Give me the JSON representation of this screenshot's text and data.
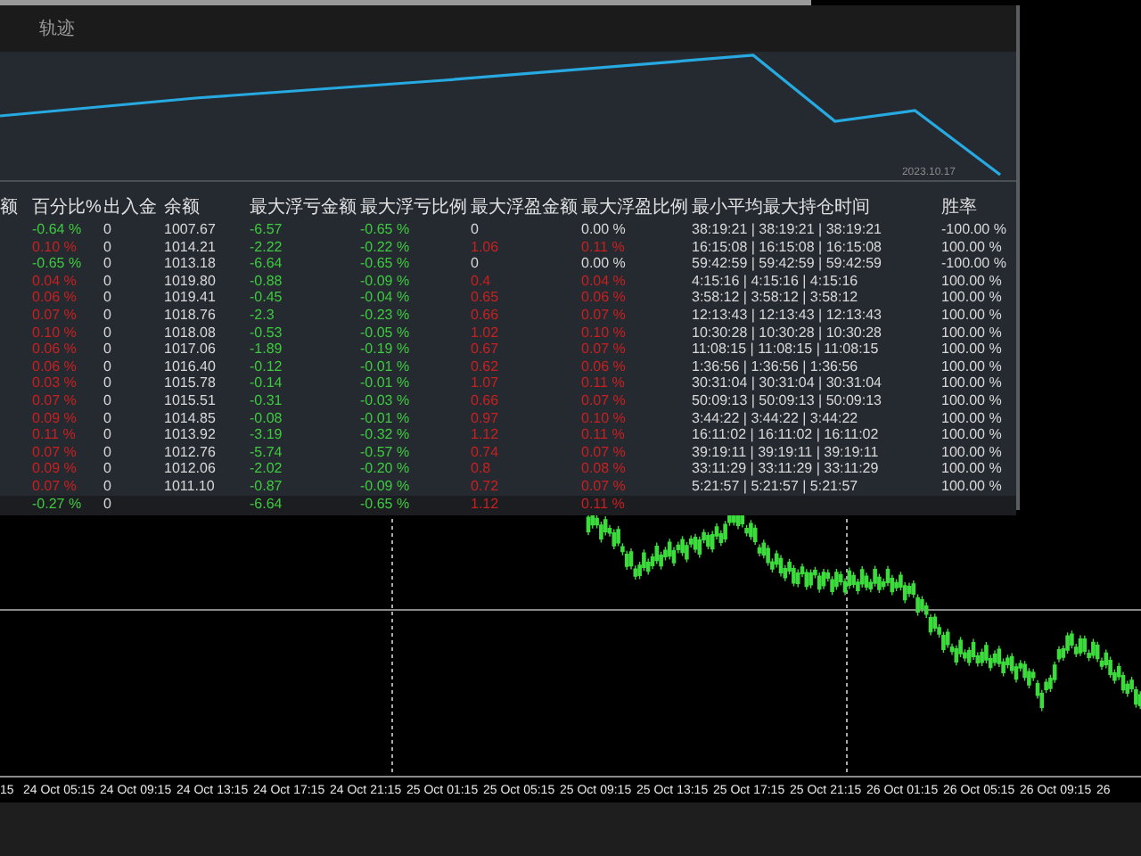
{
  "panel": {
    "title": "轨迹",
    "equity_date": "2023.10.17",
    "columns": [
      "额",
      "百分比%",
      "出入金",
      "余额",
      "最大浮亏金额",
      "最大浮亏比例",
      "最大浮盈金额",
      "最大浮盈比例",
      "最小平均最大持仓时间",
      "胜率"
    ],
    "rows": [
      {
        "percent": {
          "text": "-0.64 %",
          "color": "#3ec93e"
        },
        "flow": "0",
        "balance": "1007.67",
        "loss_amount": "-6.57",
        "loss_ratio": "-0.65 %",
        "profit_amount": {
          "text": "0",
          "color": "#d8d8d8"
        },
        "profit_ratio": {
          "text": "0.00 %",
          "color": "#d8d8d8"
        },
        "hold_time": "38:19:21 | 38:19:21 | 38:19:21",
        "win_rate": "-100.00 %"
      },
      {
        "percent": {
          "text": "0.10 %",
          "color": "#c82020"
        },
        "flow": "0",
        "balance": "1014.21",
        "loss_amount": "-2.22",
        "loss_ratio": "-0.22 %",
        "profit_amount": {
          "text": "1.06",
          "color": "#c82020"
        },
        "profit_ratio": {
          "text": "0.11 %",
          "color": "#c82020"
        },
        "hold_time": "16:15:08 | 16:15:08 | 16:15:08",
        "win_rate": "100.00 %"
      },
      {
        "percent": {
          "text": "-0.65 %",
          "color": "#3ec93e"
        },
        "flow": "0",
        "balance": "1013.18",
        "loss_amount": "-6.64",
        "loss_ratio": "-0.65 %",
        "profit_amount": {
          "text": "0",
          "color": "#d8d8d8"
        },
        "profit_ratio": {
          "text": "0.00 %",
          "color": "#d8d8d8"
        },
        "hold_time": "59:42:59 | 59:42:59 | 59:42:59",
        "win_rate": "-100.00 %"
      },
      {
        "percent": {
          "text": "0.04 %",
          "color": "#c82020"
        },
        "flow": "0",
        "balance": "1019.80",
        "loss_amount": "-0.88",
        "loss_ratio": "-0.09 %",
        "profit_amount": {
          "text": "0.4",
          "color": "#c82020"
        },
        "profit_ratio": {
          "text": "0.04 %",
          "color": "#c82020"
        },
        "hold_time": "4:15:16 | 4:15:16 | 4:15:16",
        "win_rate": "100.00 %"
      },
      {
        "percent": {
          "text": "0.06 %",
          "color": "#c82020"
        },
        "flow": "0",
        "balance": "1019.41",
        "loss_amount": "-0.45",
        "loss_ratio": "-0.04 %",
        "profit_amount": {
          "text": "0.65",
          "color": "#c82020"
        },
        "profit_ratio": {
          "text": "0.06 %",
          "color": "#c82020"
        },
        "hold_time": "3:58:12 | 3:58:12 | 3:58:12",
        "win_rate": "100.00 %"
      },
      {
        "percent": {
          "text": "0.07 %",
          "color": "#c82020"
        },
        "flow": "0",
        "balance": "1018.76",
        "loss_amount": "-2.3",
        "loss_ratio": "-0.23 %",
        "profit_amount": {
          "text": "0.66",
          "color": "#c82020"
        },
        "profit_ratio": {
          "text": "0.07 %",
          "color": "#c82020"
        },
        "hold_time": "12:13:43 | 12:13:43 | 12:13:43",
        "win_rate": "100.00 %"
      },
      {
        "percent": {
          "text": "0.10 %",
          "color": "#c82020"
        },
        "flow": "0",
        "balance": "1018.08",
        "loss_amount": "-0.53",
        "loss_ratio": "-0.05 %",
        "profit_amount": {
          "text": "1.02",
          "color": "#c82020"
        },
        "profit_ratio": {
          "text": "0.10 %",
          "color": "#c82020"
        },
        "hold_time": "10:30:28 | 10:30:28 | 10:30:28",
        "win_rate": "100.00 %"
      },
      {
        "percent": {
          "text": "0.06 %",
          "color": "#c82020"
        },
        "flow": "0",
        "balance": "1017.06",
        "loss_amount": "-1.89",
        "loss_ratio": "-0.19 %",
        "profit_amount": {
          "text": "0.67",
          "color": "#c82020"
        },
        "profit_ratio": {
          "text": "0.07 %",
          "color": "#c82020"
        },
        "hold_time": "11:08:15 | 11:08:15 | 11:08:15",
        "win_rate": "100.00 %"
      },
      {
        "percent": {
          "text": "0.06 %",
          "color": "#c82020"
        },
        "flow": "0",
        "balance": "1016.40",
        "loss_amount": "-0.12",
        "loss_ratio": "-0.01 %",
        "profit_amount": {
          "text": "0.62",
          "color": "#c82020"
        },
        "profit_ratio": {
          "text": "0.06 %",
          "color": "#c82020"
        },
        "hold_time": "1:36:56 | 1:36:56 | 1:36:56",
        "win_rate": "100.00 %"
      },
      {
        "percent": {
          "text": "0.03 %",
          "color": "#c82020"
        },
        "flow": "0",
        "balance": "1015.78",
        "loss_amount": "-0.14",
        "loss_ratio": "-0.01 %",
        "profit_amount": {
          "text": "1.07",
          "color": "#c82020"
        },
        "profit_ratio": {
          "text": "0.11 %",
          "color": "#c82020"
        },
        "hold_time": "30:31:04 | 30:31:04 | 30:31:04",
        "win_rate": "100.00 %"
      },
      {
        "percent": {
          "text": "0.07 %",
          "color": "#c82020"
        },
        "flow": "0",
        "balance": "1015.51",
        "loss_amount": "-0.31",
        "loss_ratio": "-0.03 %",
        "profit_amount": {
          "text": "0.66",
          "color": "#c82020"
        },
        "profit_ratio": {
          "text": "0.07 %",
          "color": "#c82020"
        },
        "hold_time": "50:09:13 | 50:09:13 | 50:09:13",
        "win_rate": "100.00 %"
      },
      {
        "percent": {
          "text": "0.09 %",
          "color": "#c82020"
        },
        "flow": "0",
        "balance": "1014.85",
        "loss_amount": "-0.08",
        "loss_ratio": "-0.01 %",
        "profit_amount": {
          "text": "0.97",
          "color": "#c82020"
        },
        "profit_ratio": {
          "text": "0.10 %",
          "color": "#c82020"
        },
        "hold_time": "3:44:22 | 3:44:22 | 3:44:22",
        "win_rate": "100.00 %"
      },
      {
        "percent": {
          "text": "0.11 %",
          "color": "#c82020"
        },
        "flow": "0",
        "balance": "1013.92",
        "loss_amount": "-3.19",
        "loss_ratio": "-0.32 %",
        "profit_amount": {
          "text": "1.12",
          "color": "#c82020"
        },
        "profit_ratio": {
          "text": "0.11 %",
          "color": "#c82020"
        },
        "hold_time": "16:11:02 | 16:11:02 | 16:11:02",
        "win_rate": "100.00 %"
      },
      {
        "percent": {
          "text": "0.07 %",
          "color": "#c82020"
        },
        "flow": "0",
        "balance": "1012.76",
        "loss_amount": "-5.74",
        "loss_ratio": "-0.57 %",
        "profit_amount": {
          "text": "0.74",
          "color": "#c82020"
        },
        "profit_ratio": {
          "text": "0.07 %",
          "color": "#c82020"
        },
        "hold_time": "39:19:11 | 39:19:11 | 39:19:11",
        "win_rate": "100.00 %"
      },
      {
        "percent": {
          "text": "0.09 %",
          "color": "#c82020"
        },
        "flow": "0",
        "balance": "1012.06",
        "loss_amount": "-2.02",
        "loss_ratio": "-0.20 %",
        "profit_amount": {
          "text": "0.8",
          "color": "#c82020"
        },
        "profit_ratio": {
          "text": "0.08 %",
          "color": "#c82020"
        },
        "hold_time": "33:11:29 | 33:11:29 | 33:11:29",
        "win_rate": "100.00 %"
      },
      {
        "percent": {
          "text": "0.07 %",
          "color": "#c82020"
        },
        "flow": "0",
        "balance": "1011.10",
        "loss_amount": "-0.87",
        "loss_ratio": "-0.09 %",
        "profit_amount": {
          "text": "0.72",
          "color": "#c82020"
        },
        "profit_ratio": {
          "text": "0.07 %",
          "color": "#c82020"
        },
        "hold_time": "5:21:57 | 5:21:57 | 5:21:57",
        "win_rate": "100.00 %"
      }
    ],
    "summary": {
      "percent": {
        "text": "-0.27 %",
        "color": "#3ec93e"
      },
      "flow": "0",
      "loss_amount": "-6.64",
      "loss_ratio": "-0.65 %",
      "profit_amount": {
        "text": "1.12",
        "color": "#c82020"
      },
      "profit_ratio": {
        "text": "0.11 %",
        "color": "#c82020"
      }
    }
  },
  "price_chart": {
    "time_labels": [
      "15",
      "24 Oct 05:15",
      "24 Oct 09:15",
      "24 Oct 13:15",
      "24 Oct 17:15",
      "24 Oct 21:15",
      "25 Oct 01:15",
      "25 Oct 05:15",
      "25 Oct 09:15",
      "25 Oct 13:15",
      "25 Oct 17:15",
      "25 Oct 21:15",
      "26 Oct 01:15",
      "26 Oct 05:15",
      "26 Oct 09:15",
      "26"
    ]
  }
}
